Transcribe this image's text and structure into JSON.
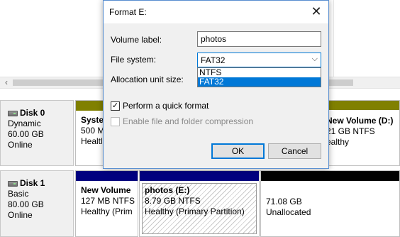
{
  "dialog": {
    "title": "Format E:",
    "close_icon": "close-icon",
    "volume_label_label": "Volume label:",
    "volume_label_value": "photos",
    "file_system_label": "File system:",
    "file_system_value": "FAT32",
    "file_system_options": [
      "NTFS",
      "FAT32"
    ],
    "allocation_unit_label": "Allocation unit size:",
    "quick_format_label": "Perform a quick format",
    "quick_format_checked": true,
    "compression_label": "Enable file and folder compression",
    "compression_enabled": false,
    "ok_label": "OK",
    "cancel_label": "Cancel"
  },
  "disks": [
    {
      "name": "Disk 0",
      "type": "Dynamic",
      "size": "60.00 GB",
      "status": "Online",
      "partitions": [
        {
          "title": "Syste",
          "line2": "500 M",
          "line3": "Healtl"
        },
        {
          "title": "New Volume  (D:)",
          "line2": "21 GB NTFS",
          "line3": "ealthy"
        }
      ]
    },
    {
      "name": "Disk 1",
      "type": "Basic",
      "size": "80.00 GB",
      "status": "Online",
      "partitions": [
        {
          "title": "New Volume",
          "line2": "127 MB NTFS",
          "line3": "Healthy (Prim"
        },
        {
          "title": "photos  (E:)",
          "line2": "8.79 GB NTFS",
          "line3": "Healthy (Primary Partition)"
        },
        {
          "title": "",
          "line2": "71.08 GB",
          "line3": "Unallocated"
        }
      ]
    }
  ],
  "scroll_left_icon": "chevron-left-icon",
  "colors": {
    "accent": "#0078d7",
    "dynamic_bar": "#808000",
    "primary_bar": "#00007f",
    "unallocated_bar": "#000000"
  }
}
